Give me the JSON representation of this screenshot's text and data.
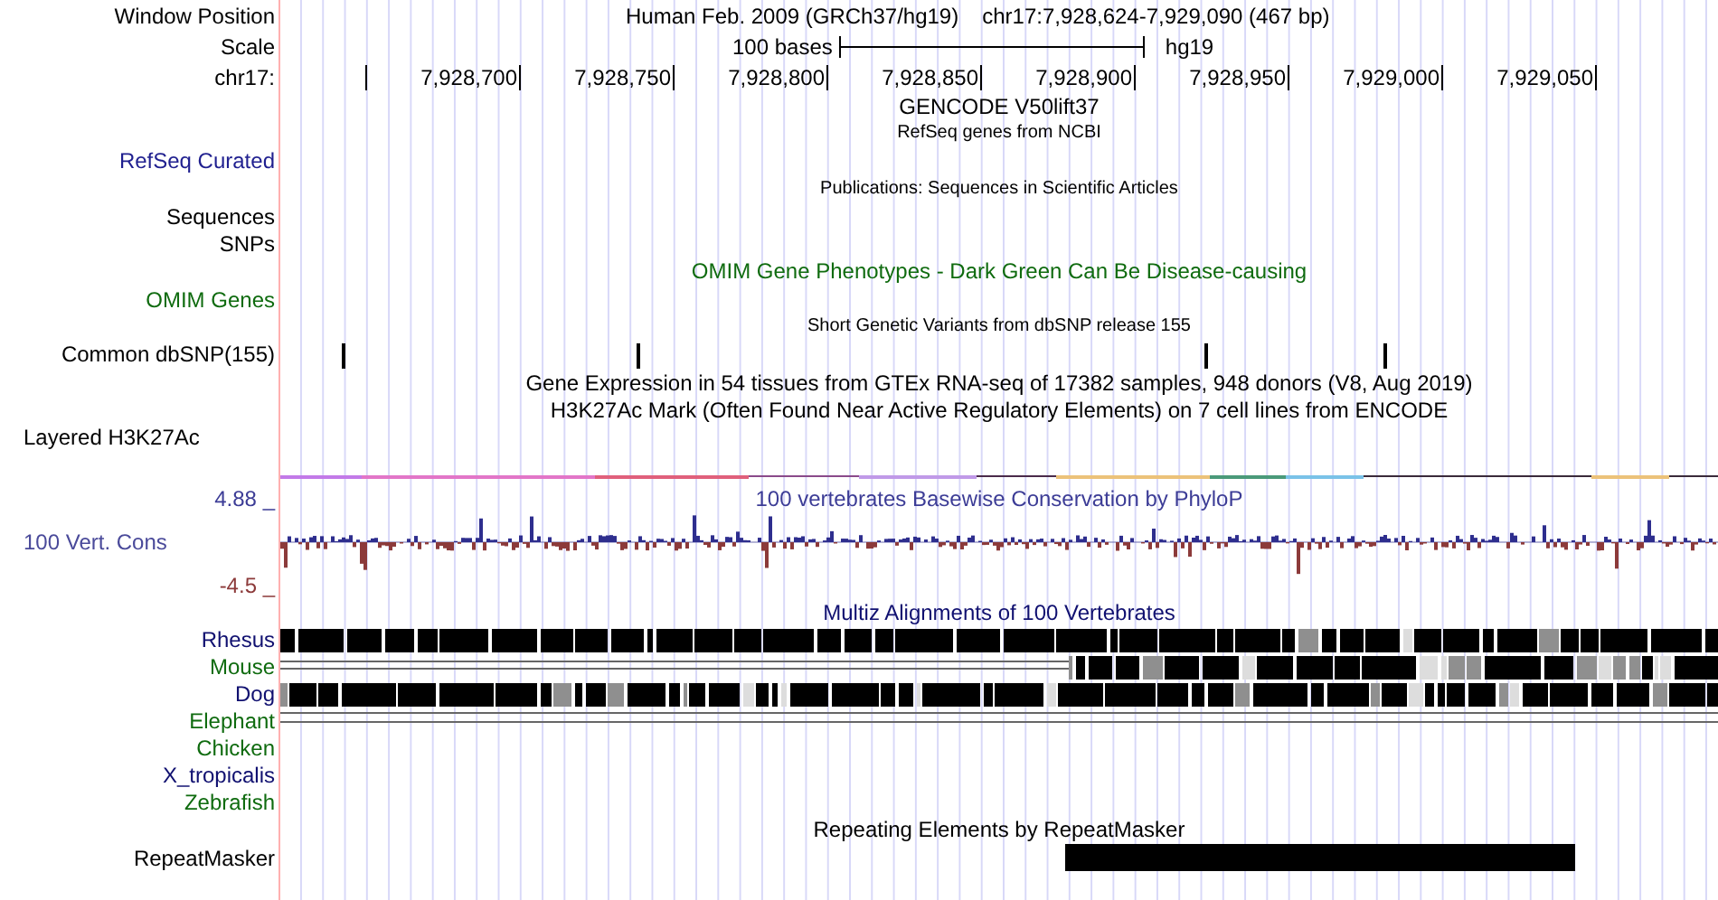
{
  "position": {
    "label": "Window Position",
    "assembly": "Human Feb. 2009 (GRCh37/hg19)",
    "range": "chr17:7,928,624-7,929,090 (467 bp)"
  },
  "scale": {
    "label": "Scale",
    "length": "100 bases",
    "db": "hg19"
  },
  "ruler": {
    "label": "chr17:",
    "ticks": [
      "7,928,700",
      "7,928,750",
      "7,928,800",
      "7,928,850",
      "7,928,900",
      "7,928,950",
      "7,929,000",
      "7,929,050"
    ]
  },
  "tracks": [
    {
      "kind": "title",
      "text": "GENCODE V50lift37",
      "color": "#000000"
    },
    {
      "kind": "note",
      "text": "RefSeq genes from NCBI"
    },
    {
      "kind": "label",
      "label": "RefSeq Curated",
      "color": "#1f1f8f"
    },
    {
      "kind": "note",
      "text": "Publications: Sequences in Scientific Articles"
    },
    {
      "kind": "label",
      "label": "Sequences",
      "color": "#000000"
    },
    {
      "kind": "label",
      "label": "SNPs",
      "color": "#000000"
    },
    {
      "kind": "title",
      "text": "OMIM Gene Phenotypes - Dark Green Can Be Disease-causing",
      "color": "#0f6b0f"
    },
    {
      "kind": "label",
      "label": "OMIM Genes",
      "color": "#0f6b0f"
    },
    {
      "kind": "note",
      "text": "Short Genetic Variants from dbSNP release 155"
    },
    {
      "kind": "snps",
      "label": "Common dbSNP(155)",
      "color": "#000000"
    },
    {
      "kind": "title",
      "text": "Gene Expression in 54 tissues from GTEx RNA-seq of 17382 samples, 948 donors (V8, Aug 2019)",
      "color": "#000000"
    },
    {
      "kind": "title",
      "text": "H3K27Ac Mark (Often Found Near Active Regulatory Elements) on 7 cell lines from ENCODE",
      "color": "#000000"
    },
    {
      "kind": "layered",
      "label": "Layered H3K27Ac",
      "color": "#000000"
    }
  ],
  "conservation": {
    "title": "100 vertebrates Basewise Conservation by PhyloP",
    "label": "100 Vert. Cons",
    "max": "4.88 _",
    "min": "-4.5 _"
  },
  "multiz": {
    "title": "Multiz Alignments of 100 Vertebrates",
    "species": [
      {
        "name": "Rhesus",
        "color": "#101070",
        "kind": "full"
      },
      {
        "name": "Mouse",
        "color": "#0f6b0f",
        "kind": "partial"
      },
      {
        "name": "Dog",
        "color": "#101070",
        "kind": "mixed"
      },
      {
        "name": "Elephant",
        "color": "#0f6b0f",
        "kind": "lines"
      },
      {
        "name": "Chicken",
        "color": "#0f6b0f",
        "kind": "empty"
      },
      {
        "name": "X_tropicalis",
        "color": "#101070",
        "kind": "empty"
      },
      {
        "name": "Zebrafish",
        "color": "#0f6b0f",
        "kind": "empty"
      }
    ]
  },
  "repeats": {
    "title": "Repeating Elements by RepeatMasker",
    "label": "RepeatMasker"
  }
}
